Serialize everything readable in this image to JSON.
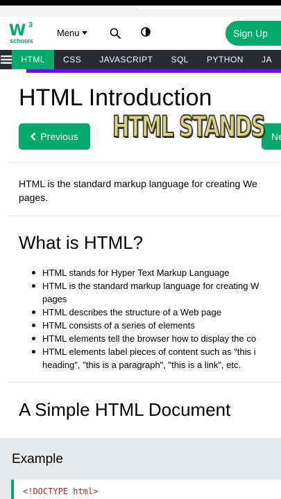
{
  "nav": {
    "logo_main": "W",
    "logo_sup": "3",
    "logo_sub": "schools",
    "menu_label": "Menu",
    "signup_label": "Sign Up"
  },
  "tabs": [
    "HTML",
    "CSS",
    "JAVASCRIPT",
    "SQL",
    "PYTHON",
    "JA"
  ],
  "page": {
    "title": "HTML Introduction",
    "prev_label": "Previous",
    "next_label": "Ne",
    "overlay_text": "HTML STANDS",
    "intro_line1": "HTML is the standard markup language for creating We",
    "intro_line2": "pages.",
    "section1_title": "What is HTML?",
    "bullets": [
      "HTML stands for Hyper Text Markup Language",
      "HTML is the standard markup language for creating W",
      "pages",
      "HTML describes the structure of a Web page",
      "HTML consists of a series of elements",
      "HTML elements tell the browser how to display the co",
      "HTML elements label pieces of content such as \"this i",
      "heading\", \"this is a paragraph\", \"this is a link\", etc."
    ],
    "section2_title": "A Simple HTML Document",
    "example_label": "Example",
    "code_first_line": "<!DOCTYPE html>"
  },
  "colors": {
    "brand_green": "#04aa6d",
    "tabbar_bg": "#282a35",
    "accent_purple": "#5b16d6"
  }
}
